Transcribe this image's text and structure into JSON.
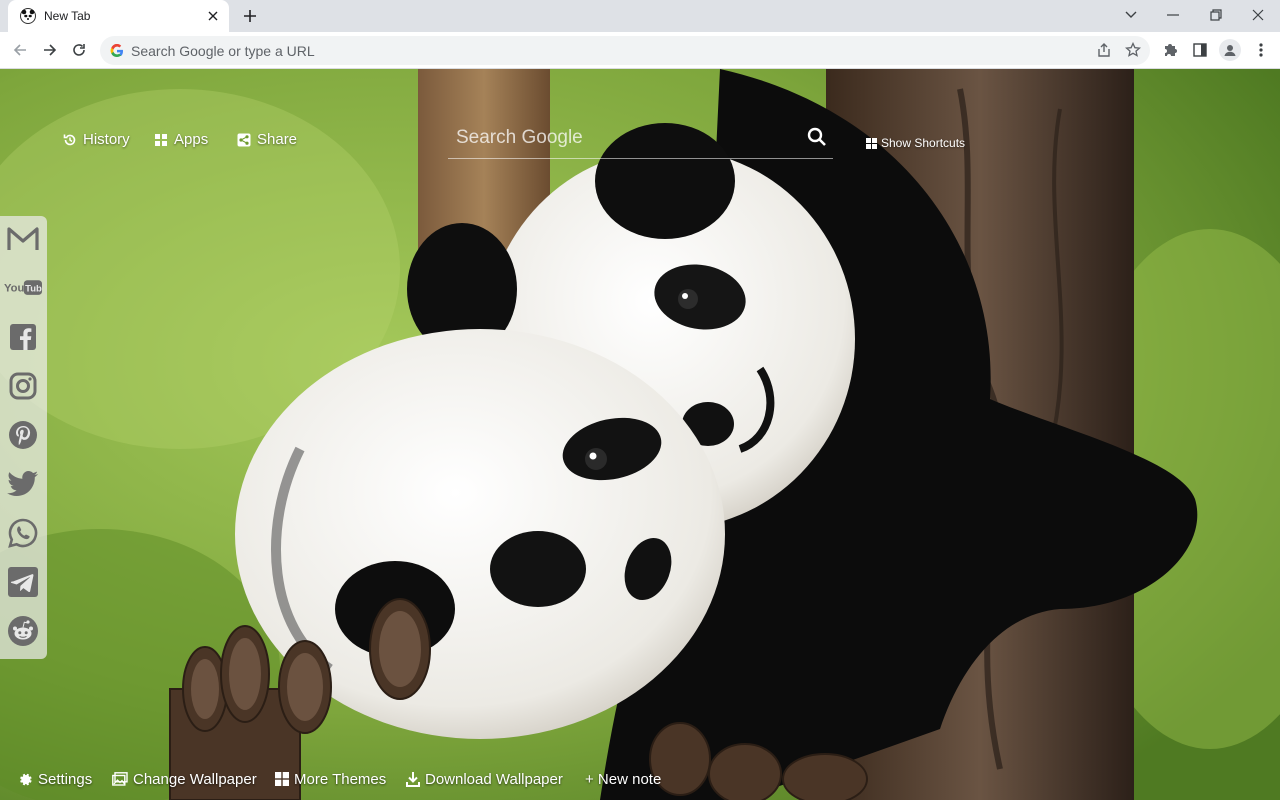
{
  "browser": {
    "tab_title": "New Tab",
    "omnibox_placeholder": "Search Google or type a URL"
  },
  "newtab": {
    "nav": {
      "history": "History",
      "apps": "Apps",
      "share": "Share"
    },
    "search_placeholder": "Search Google",
    "show_shortcuts": "Show Shortcuts",
    "sidebar": [
      "gmail-icon",
      "youtube-icon",
      "facebook-icon",
      "instagram-icon",
      "pinterest-icon",
      "twitter-icon",
      "whatsapp-icon",
      "telegram-icon",
      "reddit-icon"
    ],
    "bottom": {
      "settings": "Settings",
      "change_wallpaper": "Change Wallpaper",
      "more_themes": "More Themes",
      "download_wallpaper": "Download Wallpaper",
      "new_note": "+ New note"
    }
  },
  "colors": {
    "chrome_bg": "#dee1e6",
    "toolbar_bg": "#ffffff",
    "omnibox_bg": "#f1f3f4",
    "wallpaper_green": "#7aa53a"
  }
}
